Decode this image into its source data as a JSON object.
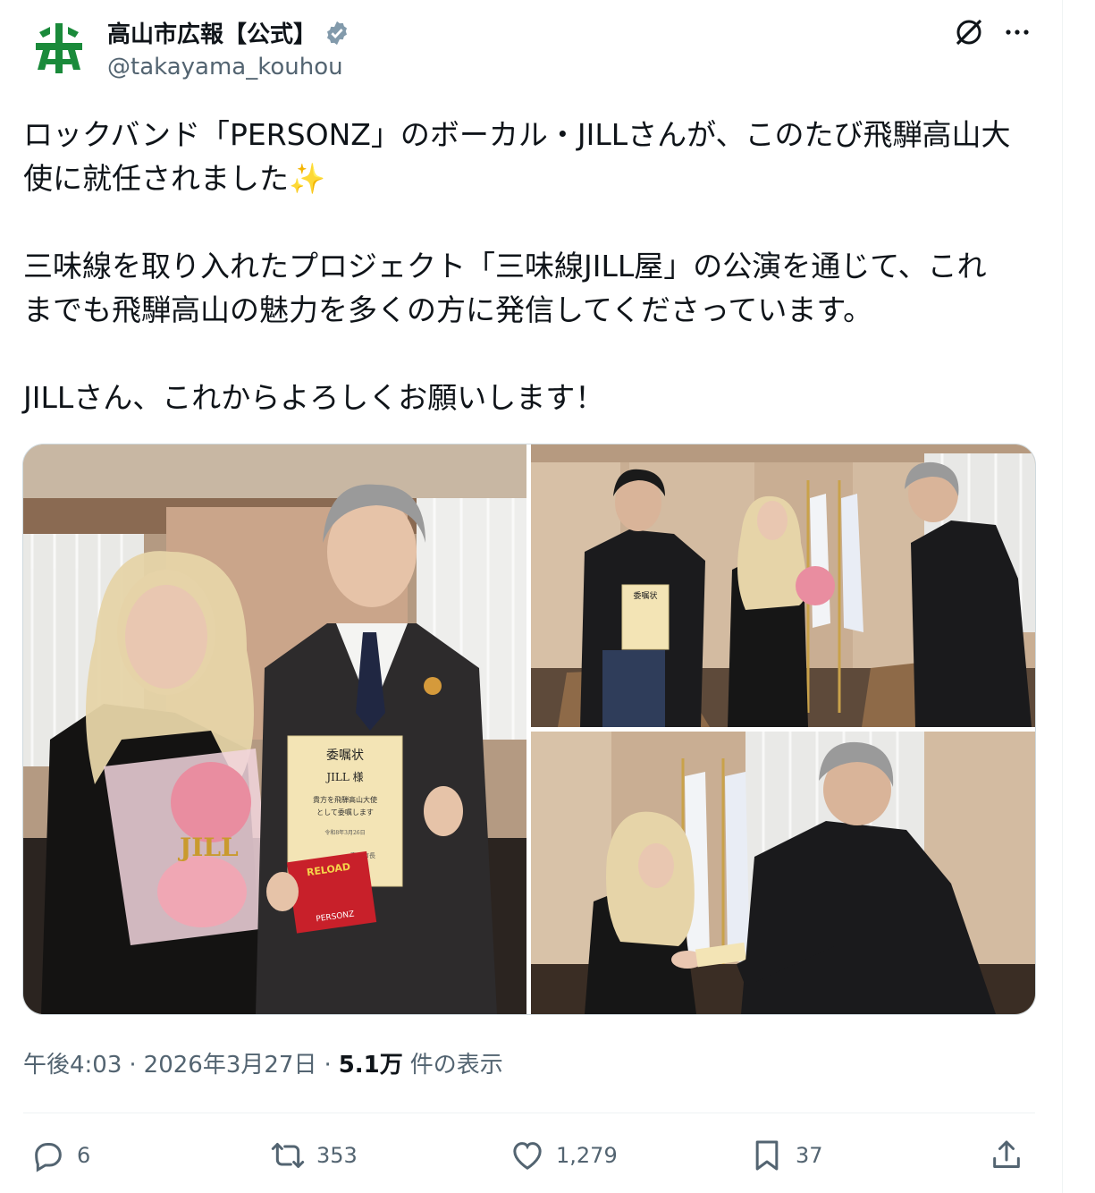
{
  "author": {
    "display_name": "高山市広報【公式】",
    "handle": "@takayama_kouhou",
    "verified": true,
    "avatar_color": "#1a8a3a"
  },
  "tweet": {
    "lines": [
      "ロックバンド「PERSONZ」のボーカル・JILLさんが、このたび飛騨高山大",
      "使に就任されました",
      "三味線を取り入れたプロジェクト「三味線JILL屋」の公演を通じて、これ",
      "までも飛騨高山の魅力を多くの方に発信してくださっています。",
      "JILLさん、これからよろしくお願いします！"
    ],
    "emoji": "✨"
  },
  "media": {
    "photo_main": {
      "certificate_title": "委嘱状",
      "certificate_name": "JILL 様",
      "certificate_body_1": "貴方を飛騨高山大使",
      "certificate_body_2": "として委嘱します",
      "certificate_small": "令和8年3月26日",
      "certificate_sign": "高山市長",
      "cd_text_1": "RELOAD",
      "cd_text_2": "PERSONZ",
      "bag_text": "JILL"
    },
    "photo_tr": {
      "certificate_title": "委嘱状"
    }
  },
  "meta": {
    "time": "午後4:03",
    "sep1": "·",
    "date": "2026年3月27日",
    "sep2": "·",
    "views_count": "5.1万",
    "views_label": "件の表示"
  },
  "actions": {
    "replies": "6",
    "reposts": "353",
    "likes": "1,279",
    "bookmarks": "37"
  },
  "colors": {
    "text": "#0f1419",
    "secondary": "#536471",
    "verified": "#829aab",
    "border": "#cfd9de"
  }
}
